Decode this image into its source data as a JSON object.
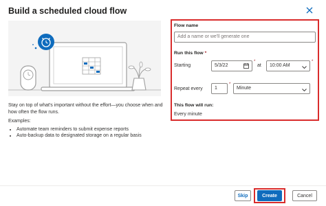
{
  "dialog": {
    "title": "Build a scheduled cloud flow",
    "close_icon": "close-icon"
  },
  "illustration": {
    "icons": [
      "alarm-clock-icon",
      "laptop-icon",
      "desk-clock-icon",
      "plant-icon"
    ],
    "accent": "#0f6cbd"
  },
  "description": {
    "intro": "Stay on top of what's important without the effort—you choose when and how often the flow runs.",
    "examples_label": "Examples:",
    "examples": [
      "Automate team reminders to submit expense reports",
      "Auto-backup data to designated storage on a regular basis"
    ]
  },
  "form": {
    "flow_name_label": "Flow name",
    "flow_name_placeholder": "Add a name or we'll generate one",
    "run_label": "Run this flow",
    "required_mark": "*",
    "starting_label": "Starting",
    "start_date": "5/3/22",
    "at_label": "at",
    "start_time": "10:00 AM",
    "repeat_label": "Repeat every",
    "repeat_value": "1",
    "repeat_unit": "Minute",
    "will_run_label": "This flow will run:",
    "will_run_value": "Every minute"
  },
  "footer": {
    "skip": "Skip",
    "create": "Create",
    "cancel": "Cancel"
  },
  "colors": {
    "highlight": "#d92b2b",
    "primary": "#0f6cbd"
  }
}
